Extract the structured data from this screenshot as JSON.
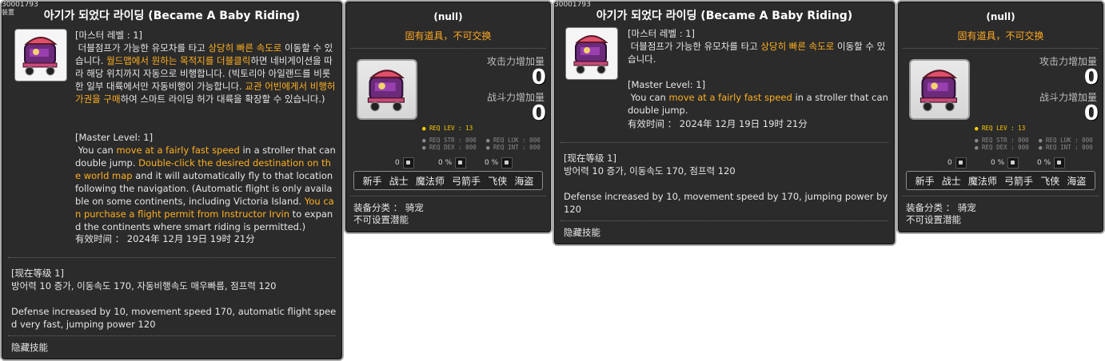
{
  "item_id": "30001793",
  "sub_tag": "装置",
  "title": "아기가 되었다 라이딩 (Became A Baby Riding)",
  "desc_kr": {
    "level_line": "[마스터 레벨 : 1]",
    "l1_a": " 더블점프가 가능한 유모차를 타고 ",
    "l1_hl": "상당히 빠른 속도로",
    "l1_b": " 이동할 수 있습니다. ",
    "l2_hl": "월드맵에서 원하는 목적지를 더블클릭",
    "l2_b": "하면 네비게이션을 따라 해당 위치까지 자동으로 비행합니다. (빅토리아 아일랜드를 비롯한 일부 대륙에서만 자동비행이 가능합니다. ",
    "l3_hl": "교관 어빈에게서 비행허가권을 구매",
    "l3_b": "하여 스마트 라이딩 허가 대륙을 확장할 수 있습니다.)"
  },
  "desc_en": {
    "level_line": "[Master Level: 1]",
    "a": " You can ",
    "hl1": "move at a fairly fast speed",
    "b": " in a stroller that can double jump. ",
    "hl2": "Double-click the desired destination on the world map",
    "c": " and it will automatically fly to that location following the navigation. (Automatic flight is only available on some continents, including Victoria Island. ",
    "hl3": "You can purchase a flight permit from Instructor Irvin",
    "d": " to expand the continents where smart riding is permitted.)"
  },
  "short_desc": {
    "kr_level": "[마스터 레벨 : 1]",
    "kr_a": " 더블점프가 가능한 유모차를 타고 ",
    "kr_hl": "상당히 빠른 속도로",
    "kr_b": " 이동할 수 있습니다.",
    "en_level": "[Master Level: 1]",
    "en_a": " You can ",
    "en_hl": "move at a fairly fast speed",
    "en_b": " in a stroller that can double jump."
  },
  "expiry": "有效时间 ： 2024年 12月 19日 19时 21分",
  "current_level": {
    "header": "[现在等级 1]",
    "kr_panel1": "방어력 10 증가, 이동속도 170, 자동비행속도 매우빠름, 점프력 120",
    "en_panel1": "Defense increased by 10, movement speed 170, automatic flight speed very fast, jumping power 120",
    "header_panel3": "[现在等级 1]",
    "kr_panel3": "방어력 10 증가, 이동속도 170, 점프력 120",
    "en_panel3": "Defense increased by 10, movement speed by 170, jumping power by 120"
  },
  "hidden_skill": "隐藏技能",
  "item_panel": {
    "name": "(null)",
    "fixed": "固有道具，不可交换",
    "attack_label": "攻击力增加量",
    "attack_value": "0",
    "power_label": "战斗力增加量",
    "power_value": "0",
    "req_lev": "● REQ LEV :   13",
    "req_str": "● REQ STR : 000",
    "req_dex": "● REQ DEX : 000",
    "req_luk": "● REQ LUK : 000",
    "req_int": "● REQ INT : 000",
    "sym1": "0",
    "sym2": "0 %",
    "sym3": "0 %",
    "jobs": [
      "新手",
      "战士",
      "魔法师",
      "弓箭手",
      "飞侠",
      "海盗"
    ],
    "category": "装备分类 ： 骑宠",
    "potential": "不可设置潜能"
  },
  "colors": {
    "panel_bg": "#2b2b2b",
    "highlight": "#ffb020",
    "border": "#a9a9a9"
  }
}
